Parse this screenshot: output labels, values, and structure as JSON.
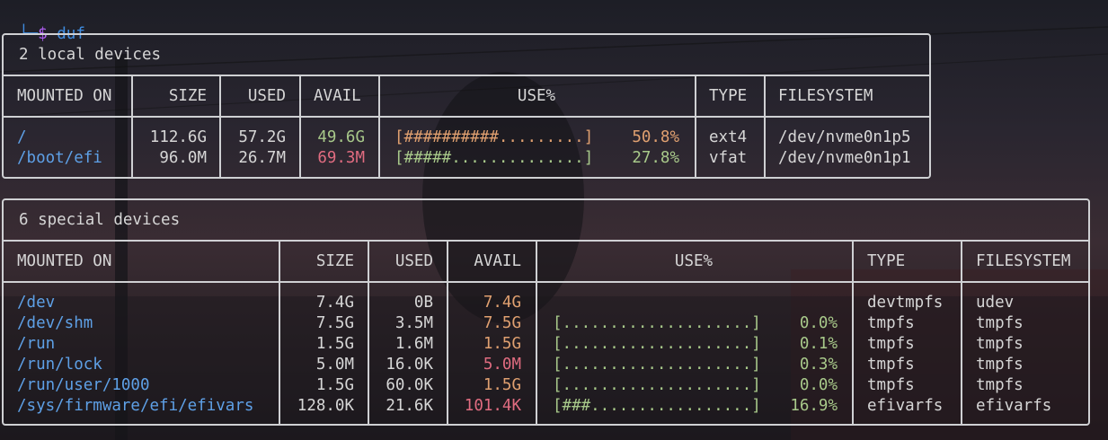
{
  "prompt": {
    "tree": "└─",
    "dollar": "$",
    "command": "duf"
  },
  "colors": {
    "mount": "#5ea0e6",
    "green": "#a8c98a",
    "red": "#e06c80",
    "orange": "#e0a070",
    "border": "#cfd0d3",
    "prompt_blue": "#3f8ce0",
    "prompt_purple": "#b15ff5"
  },
  "local": {
    "title": "2 local devices",
    "headers": [
      "MOUNTED ON",
      "SIZE",
      "USED",
      "AVAIL",
      "USE%",
      "TYPE",
      "FILESYSTEM"
    ],
    "rows": [
      {
        "mount": "/",
        "size": "112.6G",
        "used": "57.2G",
        "avail": "49.6G",
        "bar": "[##########.........]",
        "pct": "50.8%",
        "type": "ext4",
        "fs": "/dev/nvme0n1p5"
      },
      {
        "mount": "/boot/efi",
        "size": "96.0M",
        "used": "26.7M",
        "avail": "69.3M",
        "bar": "[#####..............]",
        "pct": "27.8%",
        "type": "vfat",
        "fs": "/dev/nvme0n1p1"
      }
    ]
  },
  "special": {
    "title": "6 special devices",
    "headers": [
      "MOUNTED ON",
      "SIZE",
      "USED",
      "AVAIL",
      "USE%",
      "TYPE",
      "FILESYSTEM"
    ],
    "rows": [
      {
        "mount": "/dev",
        "size": "7.4G",
        "used": "0B",
        "avail": "7.4G",
        "bar": "",
        "pct": "",
        "type": "devtmpfs",
        "fs": "udev"
      },
      {
        "mount": "/dev/shm",
        "size": "7.5G",
        "used": "3.5M",
        "avail": "7.5G",
        "bar": "[....................]",
        "pct": "0.0%",
        "type": "tmpfs",
        "fs": "tmpfs"
      },
      {
        "mount": "/run",
        "size": "1.5G",
        "used": "1.6M",
        "avail": "1.5G",
        "bar": "[....................]",
        "pct": "0.1%",
        "type": "tmpfs",
        "fs": "tmpfs"
      },
      {
        "mount": "/run/lock",
        "size": "5.0M",
        "used": "16.0K",
        "avail": "5.0M",
        "bar": "[....................]",
        "pct": "0.3%",
        "type": "tmpfs",
        "fs": "tmpfs"
      },
      {
        "mount": "/run/user/1000",
        "size": "1.5G",
        "used": "60.0K",
        "avail": "1.5G",
        "bar": "[....................]",
        "pct": "0.0%",
        "type": "tmpfs",
        "fs": "tmpfs"
      },
      {
        "mount": "/sys/firmware/efi/efivars",
        "size": "128.0K",
        "used": "21.6K",
        "avail": "101.4K",
        "bar": "[###.................]",
        "pct": "16.9%",
        "type": "efivarfs",
        "fs": "efivarfs"
      }
    ]
  }
}
